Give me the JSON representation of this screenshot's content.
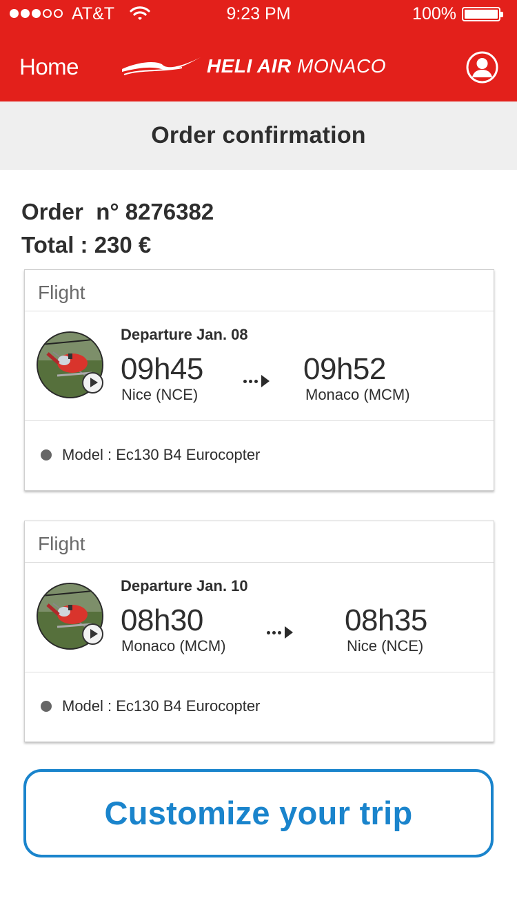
{
  "status_bar": {
    "carrier": "AT&T",
    "time": "9:23 PM",
    "battery": "100%",
    "signal_bars_filled": 3,
    "signal_bars_total": 5
  },
  "nav": {
    "home_label": "Home",
    "brand_bold": "HELI AIR",
    "brand_light": "MONACO",
    "profile_icon": "user-profile-icon"
  },
  "page": {
    "title": "Order confirmation"
  },
  "order": {
    "number_label": "Order  n° 8276382",
    "total_label": "Total : 230 €"
  },
  "flights": [
    {
      "header": "Flight",
      "departure": "Departure Jan. 08",
      "from_time": "09h45",
      "from_place": "Nice (NCE)",
      "to_time": "09h52",
      "to_place": "Monaco (MCM)",
      "model": "Model : Ec130 B4 Eurocopter"
    },
    {
      "header": "Flight",
      "departure": "Departure Jan. 10",
      "from_time": "08h30",
      "from_place": "Monaco (MCM)",
      "to_time": "08h35",
      "to_place": "Nice (NCE)",
      "model": "Model : Ec130 B4 Eurocopter"
    }
  ],
  "cta": {
    "label": "Customize your trip"
  },
  "colors": {
    "brand_red": "#e3201b",
    "header_bg": "#efefef",
    "cta_blue": "#1a84cc"
  }
}
